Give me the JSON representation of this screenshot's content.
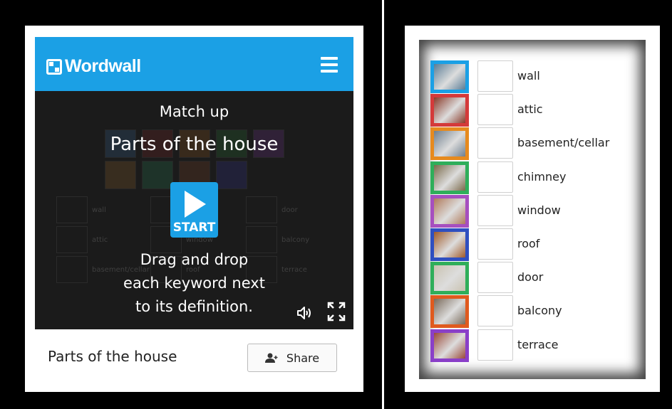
{
  "left": {
    "brand": "Wordwall",
    "game_type": "Match up",
    "game_title": "Parts of the house",
    "start_label": "START",
    "instructions": [
      "Drag and drop",
      "each keyword next",
      "to its definition."
    ],
    "footer_title": "Parts of the house",
    "share_label": "Share",
    "ghost_words": [
      "wall",
      "door",
      "attic",
      "window",
      "balcony",
      "basement/cellar",
      "roof",
      "terrace"
    ],
    "icons": {
      "sound": "speaker-icon",
      "fullscreen": "fullscreen-icon",
      "menu": "hamburger-menu-icon",
      "share": "person-icon"
    }
  },
  "right": {
    "items": [
      {
        "word": "wall",
        "frame_color": "#1ba0e5",
        "pic_color": "#5a7d96"
      },
      {
        "word": "attic",
        "frame_color": "#d43a3a",
        "pic_color": "#8a3b2a"
      },
      {
        "word": "basement/cellar",
        "frame_color": "#e68a1e",
        "pic_color": "#6f7f8e"
      },
      {
        "word": "chimney",
        "frame_color": "#2fae5a",
        "pic_color": "#7a6a4a"
      },
      {
        "word": "window",
        "frame_color": "#a64fbf",
        "pic_color": "#b07a5a"
      },
      {
        "word": "roof",
        "frame_color": "#2f4fc0",
        "pic_color": "#a05a2a"
      },
      {
        "word": "door",
        "frame_color": "#2fae5a",
        "pic_color": "#c9c2b0"
      },
      {
        "word": "balcony",
        "frame_color": "#e05a1e",
        "pic_color": "#7a6a5a"
      },
      {
        "word": "terrace",
        "frame_color": "#8a3fc8",
        "pic_color": "#9a4a3a"
      }
    ]
  }
}
